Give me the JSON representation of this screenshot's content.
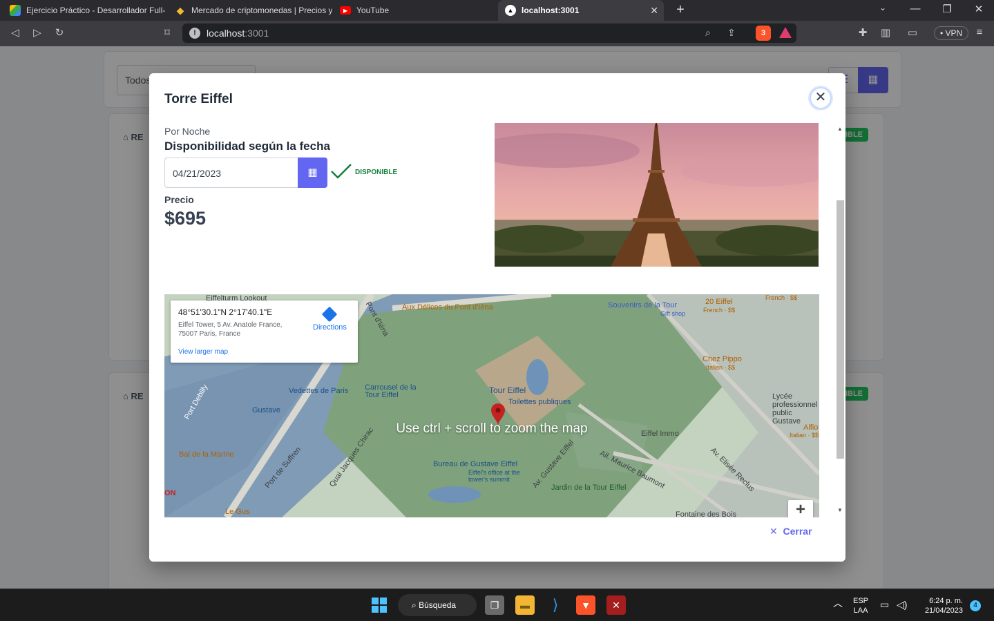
{
  "browser": {
    "tabs": [
      {
        "title": "Ejercicio Práctico - Desarrollador Full-s",
        "favicon": "drive-icon"
      },
      {
        "title": "Mercado de criptomonedas | Precios y",
        "favicon": "binance-icon"
      },
      {
        "title": "YouTube",
        "favicon": "youtube-icon"
      },
      {
        "title": "localhost:3001",
        "favicon": "app-icon"
      }
    ],
    "url_host": "localhost",
    "url_port": ":3001",
    "shield_count": "3",
    "vpn_label": "VPN"
  },
  "page": {
    "filter_value": "Todos",
    "card_tag": "RE",
    "badge": "NIBLE"
  },
  "modal": {
    "title": "Torre Eiffel",
    "cut_char": "'",
    "per_night": "Por Noche",
    "availability_title": "Disponibilidad según la fecha",
    "date_value": "04/21/2023",
    "availability_status": "DISPONIBLE",
    "price_label": "Precio",
    "price_value": "$695",
    "close_label": "Cerrar",
    "accent_color": "#6366f1"
  },
  "map": {
    "coordinates": "48°51'30.1\"N 2°17'40.1\"E",
    "address": "Eiffel Tower, 5 Av. Anatole France, 75007 Paris, France",
    "directions_label": "Directions",
    "larger_map_label": "View larger map",
    "hint": "Use ctrl + scroll to zoom the map",
    "labels": {
      "l1": "Aux Délices du Pont d'Iéna",
      "l2": "Souvenirs de la Tour",
      "l3": "Gift shop",
      "l4": "20 Eiffel",
      "l5": "French · $$",
      "l6": "Chez Pippo",
      "l7": "Italian · $$",
      "l8": "Vedettes de Paris",
      "l9": "Carrousel de la Tour Eiffel",
      "l10": "Tour Eiffel",
      "l11": "Toilettes publiques",
      "l12": "Gustave",
      "l13": "Lycée professionnel public Gustave",
      "l14": "Eiffel Immo",
      "l15": "Alfio",
      "l16": "Italian · $$",
      "l17": "Bal de la Marine",
      "l18": "Bureau de Gustave Eiffel",
      "l19": "Eiffel's office at the tower's summit",
      "l20": "Jardin de la Tour Eiffel",
      "l21": "Le Gus",
      "l22": "Pont d'Iéna",
      "l23": "Quai Jacques Chirac",
      "l24": "Av. Gustave Eiffel",
      "l25": "Av. Elisée Reclus",
      "l26": "All. Maurice Baumont",
      "l27": "Port de Suffren",
      "l28": "Fontaine des Bois",
      "l29": "Eiffelturm Lookout",
      "l30": "ON",
      "l31": "Port Debilly",
      "l32": "French · $$"
    }
  },
  "taskbar": {
    "search_label": "Búsqueda",
    "lang_top": "ESP",
    "lang_bottom": "LAA",
    "time": "6:24 p. m.",
    "date": "21/04/2023",
    "notifications": "4"
  }
}
